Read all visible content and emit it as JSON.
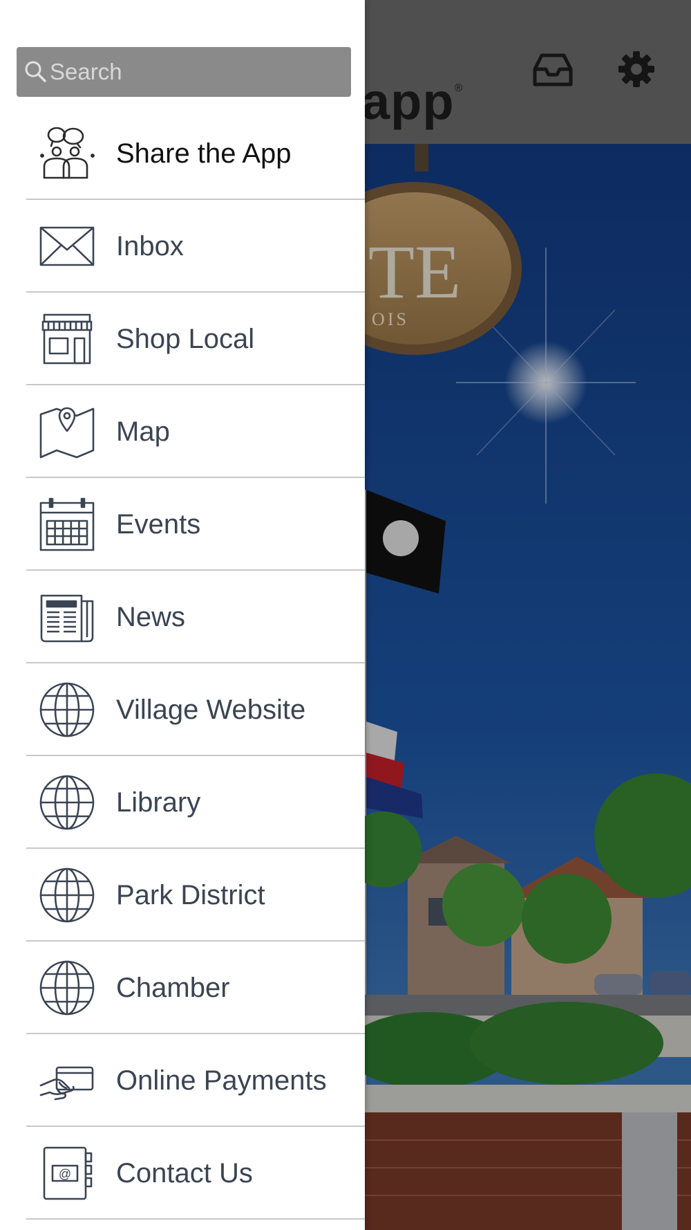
{
  "header": {
    "logo_text": "app",
    "registered_mark": "®"
  },
  "search": {
    "placeholder": "Search"
  },
  "menu": {
    "items": [
      {
        "label": "Share the App",
        "icon": "people-icon"
      },
      {
        "label": "Inbox",
        "icon": "envelope-icon"
      },
      {
        "label": "Shop Local",
        "icon": "storefront-icon"
      },
      {
        "label": "Map",
        "icon": "map-icon"
      },
      {
        "label": "Events",
        "icon": "calendar-icon"
      },
      {
        "label": "News",
        "icon": "newspaper-icon"
      },
      {
        "label": "Village Website",
        "icon": "globe-icon"
      },
      {
        "label": "Library",
        "icon": "globe-icon"
      },
      {
        "label": "Park District",
        "icon": "globe-icon"
      },
      {
        "label": "Chamber",
        "icon": "globe-icon"
      },
      {
        "label": "Online Payments",
        "icon": "payment-card-icon"
      },
      {
        "label": "Contact Us",
        "icon": "address-book-icon"
      }
    ]
  },
  "colors": {
    "drawer_bg": "#ffffff",
    "search_bg": "#8a8a8a",
    "label": "#3b4452",
    "icon_stroke": "#3b4452",
    "divider": "#c8c8c8"
  }
}
